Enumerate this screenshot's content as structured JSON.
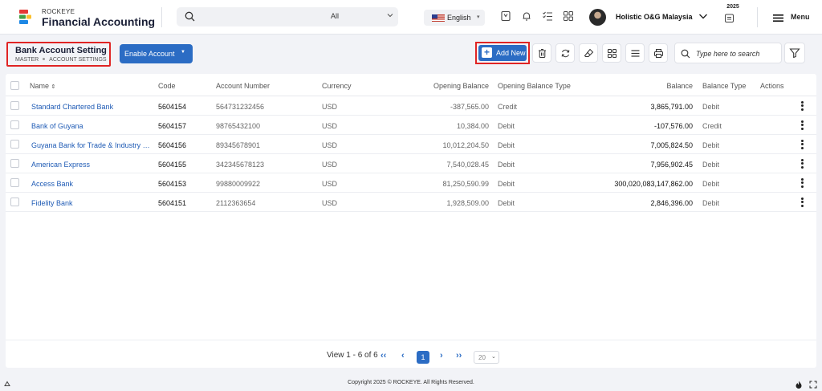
{
  "header": {
    "brand_top": "ROCKEYE",
    "brand_main": "Financial Accounting",
    "search_scope": "All",
    "language": "English",
    "user_name": "Holistic O&G Malaysia",
    "year": "2025",
    "menu_label": "Menu"
  },
  "page": {
    "title": "Bank Account Setting",
    "breadcrumb": [
      "MASTER",
      "ACCOUNT SETTINGS"
    ]
  },
  "toolbar": {
    "enable_label": "Enable Account",
    "add_label": "Add New",
    "search_placeholder": "Type here to search"
  },
  "table": {
    "columns": {
      "name": "Name",
      "code": "Code",
      "account_number": "Account Number",
      "currency": "Currency",
      "opening_balance": "Opening Balance",
      "opening_balance_type": "Opening Balance Type",
      "balance": "Balance",
      "balance_type": "Balance Type",
      "actions": "Actions"
    },
    "rows": [
      {
        "name": "Standard Chartered Bank",
        "code": "5604154",
        "account_number": "564731232456",
        "currency": "USD",
        "opening_balance": "-387,565.00",
        "opening_balance_type": "Credit",
        "balance": "3,865,791.00",
        "balance_type": "Debit"
      },
      {
        "name": "Bank of Guyana",
        "code": "5604157",
        "account_number": "98765432100",
        "currency": "USD",
        "opening_balance": "10,384.00",
        "opening_balance_type": "Debit",
        "balance": "-107,576.00",
        "balance_type": "Credit"
      },
      {
        "name": "Guyana Bank for Trade & Industry Li...",
        "code": "5604156",
        "account_number": "89345678901",
        "currency": "USD",
        "opening_balance": "10,012,204.50",
        "opening_balance_type": "Debit",
        "balance": "7,005,824.50",
        "balance_type": "Debit"
      },
      {
        "name": "American Express",
        "code": "5604155",
        "account_number": "342345678123",
        "currency": "USD",
        "opening_balance": "7,540,028.45",
        "opening_balance_type": "Debit",
        "balance": "7,956,902.45",
        "balance_type": "Debit"
      },
      {
        "name": "Access Bank",
        "code": "5604153",
        "account_number": "99880009922",
        "currency": "USD",
        "opening_balance": "81,250,590.99",
        "opening_balance_type": "Debit",
        "balance": "300,020,083,147,862.00",
        "balance_type": "Debit"
      },
      {
        "name": "Fidelity Bank",
        "code": "5604151",
        "account_number": "2112363654",
        "currency": "USD",
        "opening_balance": "1,928,509.00",
        "opening_balance_type": "Debit",
        "balance": "2,846,396.00",
        "balance_type": "Debit"
      }
    ]
  },
  "pagination": {
    "view_text": "View 1 - 6 of 6",
    "current_page": "1",
    "page_size": "20"
  },
  "footer": {
    "copyright": "Copyright 2025 © ROCKEYE. All Rights Reserved."
  },
  "colors": {
    "primary": "#2b6cc4",
    "highlight_border": "#e02424",
    "link": "#1f5bb5"
  }
}
